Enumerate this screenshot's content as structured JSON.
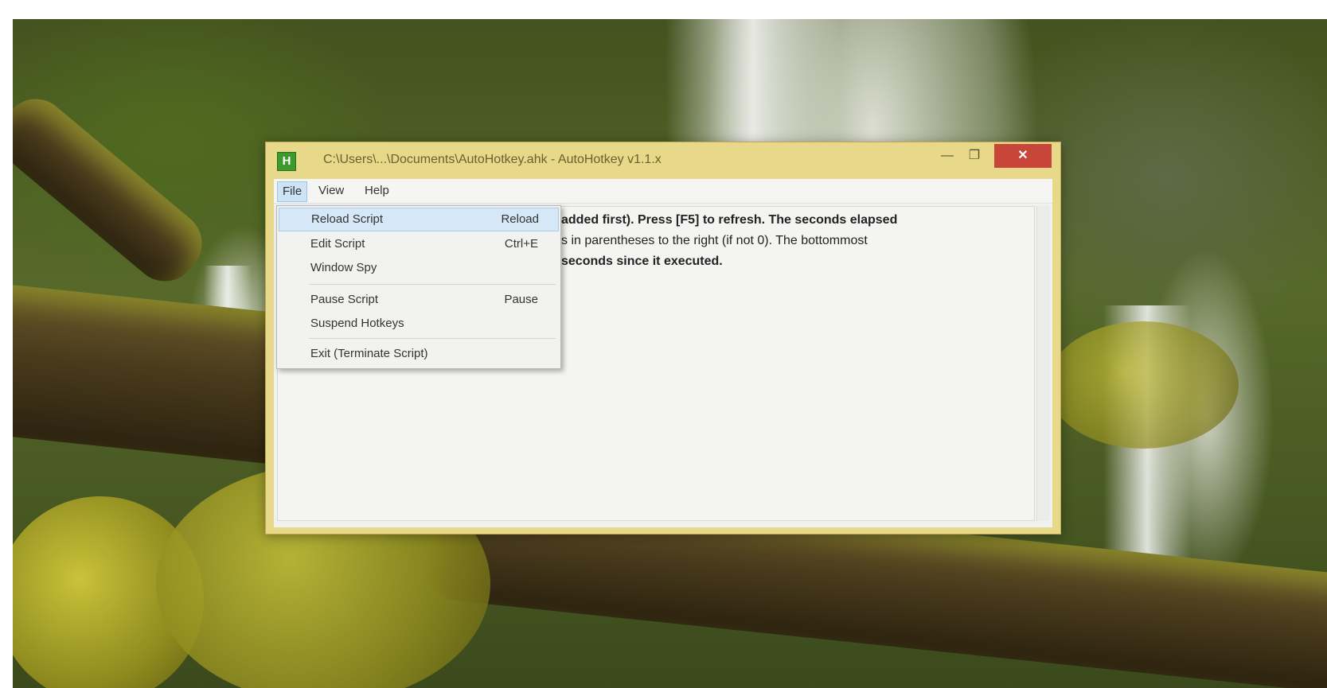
{
  "window": {
    "title": "C:\\Users\\...\\Documents\\AutoHotkey.ahk - AutoHotkey v1.1.x",
    "icon_label": "H",
    "minimize_glyph": "—",
    "maximize_glyph": "❐",
    "close_glyph": "✕"
  },
  "menu_bar": {
    "items": [
      {
        "label": "File"
      },
      {
        "label": "View"
      },
      {
        "label": "Help"
      }
    ]
  },
  "file_menu": {
    "items": [
      {
        "label": "Reload Script",
        "shortcut": "Reload"
      },
      {
        "label": "Edit Script",
        "shortcut": "Ctrl+E"
      },
      {
        "label": "Window Spy",
        "shortcut": ""
      },
      {
        "label": "Pause Script",
        "shortcut": "Pause"
      },
      {
        "label": "Suspend Hotkeys",
        "shortcut": ""
      },
      {
        "label": "Exit (Terminate Script)",
        "shortcut": ""
      }
    ]
  },
  "content": {
    "line1_bold": "added first). Press [F5] to refresh. The seconds elapsed",
    "line2": "s in parentheses to the right (if not 0). The bottommost",
    "line3_bold": "seconds since it executed."
  }
}
